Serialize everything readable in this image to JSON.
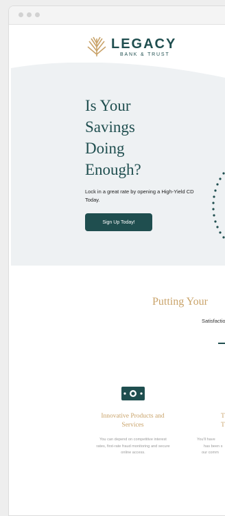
{
  "brand": {
    "name": "LEGACY",
    "tagline": "BANK & TRUST"
  },
  "hero": {
    "title_lines": [
      "Is Your",
      "Savings",
      "Doing",
      "Enough?"
    ],
    "subtitle": "Lock in a great rate by opening a High-Yield CD Today.",
    "cta_label": "Sign Up Today!"
  },
  "section": {
    "title": "Putting Your",
    "subtitle": "Satisfactio"
  },
  "features": [
    {
      "icon": "money-icon",
      "title": "Innovative Products and Services",
      "body": "You can depend on competitive interest rates, first-rate fraud monitoring and secure online access."
    },
    {
      "title": "T\nT",
      "body_lines": [
        "You'll have",
        "has been s",
        "our comm"
      ]
    }
  ],
  "colors": {
    "primary": "#1f4e4f",
    "accent_gold": "#c9a36a",
    "hero_bg": "#eef1f3"
  }
}
